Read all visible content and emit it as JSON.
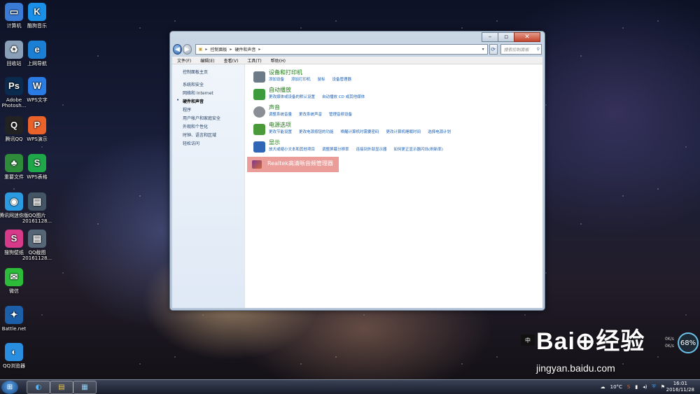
{
  "desktop": {
    "icons": [
      {
        "label": "计算机",
        "glyph": "▭",
        "color": "#3a7bd5"
      },
      {
        "label": "酷狗音乐",
        "glyph": "K",
        "color": "#1a8fe8"
      },
      {
        "label": "回收站",
        "glyph": "♻",
        "color": "#8aa0b8"
      },
      {
        "label": "上网导航",
        "glyph": "e",
        "color": "#1b7fd4"
      },
      {
        "label": "Adobe Photosh...",
        "glyph": "Ps",
        "color": "#0a2a4e"
      },
      {
        "label": "WPS文字",
        "glyph": "W",
        "color": "#2a7be4"
      },
      {
        "label": "腾讯QQ",
        "glyph": "Q",
        "color": "#222222"
      },
      {
        "label": "WPS演示",
        "glyph": "P",
        "color": "#e8622a"
      },
      {
        "label": "重要文件",
        "glyph": "♣",
        "color": "#2e8b3a"
      },
      {
        "label": "WPS表格",
        "glyph": "S",
        "color": "#1fa84a"
      },
      {
        "label": "腾讯网迷你版",
        "glyph": "◉",
        "color": "#2a9be0"
      },
      {
        "label": "QQ图片 20161128...",
        "glyph": "▤",
        "color": "#445566"
      },
      {
        "label": "搜狗壁纸",
        "glyph": "S",
        "color": "#d83a8a"
      },
      {
        "label": "QQ截图 20161128...",
        "glyph": "▤",
        "color": "#556677"
      },
      {
        "label": "微信",
        "glyph": "✉",
        "color": "#2dbb3a"
      },
      {
        "label": "Battle.net",
        "glyph": "✦",
        "color": "#1c5fa8"
      },
      {
        "label": "QQ浏览器",
        "glyph": "◐",
        "color": "#2a8ee0"
      }
    ]
  },
  "window": {
    "breadcrumb": [
      "控制面板",
      "硬件和声音"
    ],
    "search_placeholder": "搜索控制面板",
    "controls": {
      "minimize": "–",
      "maximize": "▫",
      "close": "✕"
    },
    "menu": [
      "文件(F)",
      "编辑(E)",
      "查看(V)",
      "工具(T)",
      "帮助(H)"
    ],
    "leftnav": {
      "home": "控制面板主页",
      "items": [
        "系统和安全",
        "网络和 Internet",
        "硬件和声音",
        "程序",
        "用户帐户和家庭安全",
        "外观和个性化",
        "时钟、语言和区域",
        "轻松访问"
      ]
    },
    "categories": [
      {
        "title": "设备和打印机",
        "links": [
          "添加设备",
          "添加打印机",
          "鼠标",
          "设备管理器"
        ],
        "icon_color": "#6d7a88"
      },
      {
        "title": "自动播放",
        "links": [
          "更改媒体或设备的默认设置",
          "自动播放 CD 或其他媒体"
        ],
        "icon_color": "#3d9b3d"
      },
      {
        "title": "声音",
        "links": [
          "调整系统音量",
          "更改系统声音",
          "管理音频设备"
        ],
        "icon_color": "#8a8f96"
      },
      {
        "title": "电源选项",
        "links": [
          "更改节能设置",
          "更改电源按钮的功能",
          "唤醒计算机时需要密码",
          "更改计算机睡眠时间",
          "选择电源计划"
        ],
        "icon_color": "#4a9a3a"
      },
      {
        "title": "显示",
        "links": [
          "放大或缩小文本和其他项目",
          "调整屏幕分辨率",
          "连接到外部显示器",
          "如何更正显示器闪烁(刷新率)"
        ],
        "icon_color": "#2f66b5"
      }
    ],
    "realtek_label": "Realtek高清晰音频管理器"
  },
  "overlay": {
    "ime": "中",
    "watermark": "Bai⊕经验",
    "watermark_url": "jingyan.baidu.com",
    "netspeed_up": "0K/s",
    "netspeed_down": "0K/s",
    "gauge": "68%"
  },
  "taskbar": {
    "weather": "10°C",
    "time": "16:01",
    "date": "2016/11/28"
  }
}
